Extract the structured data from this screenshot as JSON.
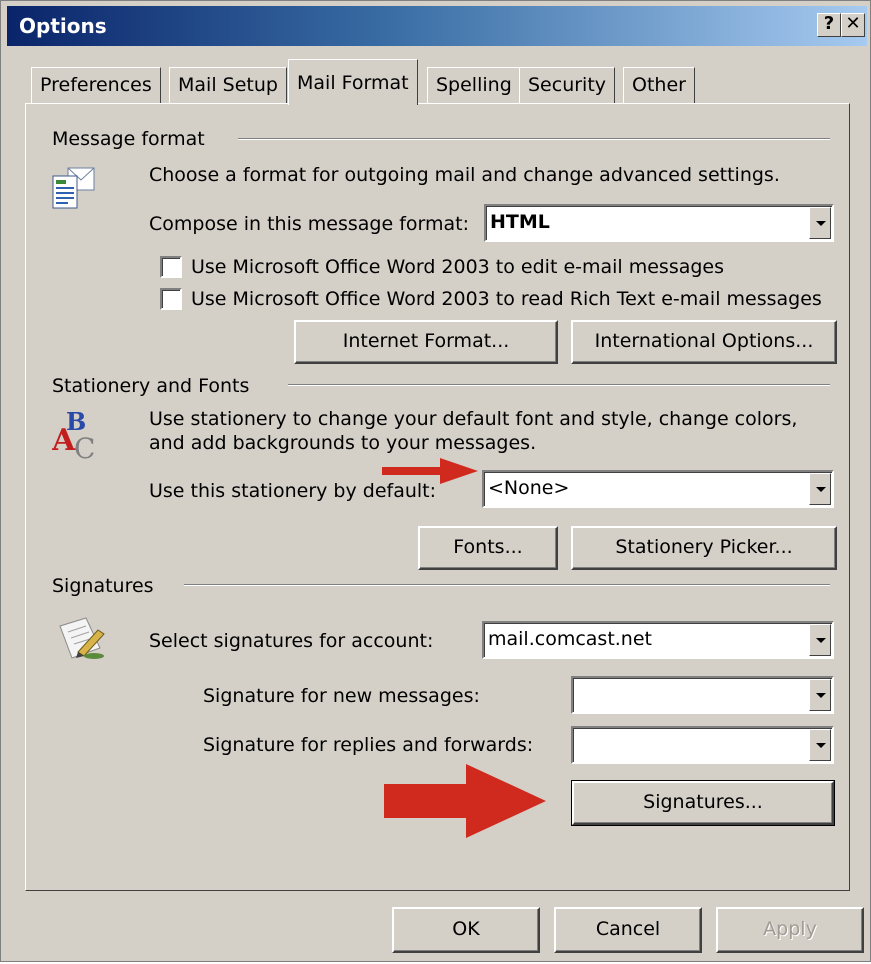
{
  "window": {
    "title": "Options",
    "help_label": "?",
    "close_label": "✕"
  },
  "tabs": [
    {
      "label": "Preferences"
    },
    {
      "label": "Mail Setup"
    },
    {
      "label": "Mail Format",
      "active": true
    },
    {
      "label": "Spelling"
    },
    {
      "label": "Security"
    },
    {
      "label": "Other"
    }
  ],
  "message_format": {
    "heading": "Message format",
    "description": "Choose a format for outgoing mail and change advanced settings.",
    "compose_label": "Compose in this message format:",
    "compose_value": "HTML",
    "word_edit_label": "Use Microsoft Office Word 2003 to edit e-mail messages",
    "word_read_label": "Use Microsoft Office Word 2003 to read Rich Text e-mail messages",
    "word_edit_checked": false,
    "word_read_checked": false,
    "internet_format_button": "Internet Format...",
    "international_options_button": "International Options..."
  },
  "stationery": {
    "heading": "Stationery and Fonts",
    "description_line1": "Use stationery to change your default font and style, change colors,",
    "description_line2": "and add backgrounds to your messages.",
    "default_label": "Use this stationery by default:",
    "default_value": "<None>",
    "fonts_button": "Fonts...",
    "picker_button": "Stationery Picker..."
  },
  "signatures": {
    "heading": "Signatures",
    "account_label": "Select signatures for account:",
    "account_value": "mail.comcast.net",
    "new_messages_label": "Signature for new messages:",
    "new_messages_value": "",
    "replies_label": "Signature for replies and forwards:",
    "replies_value": "",
    "signatures_button": "Signatures..."
  },
  "footer": {
    "ok_label": "OK",
    "cancel_label": "Cancel",
    "apply_label": "Apply"
  },
  "colors": {
    "annotation_arrow": "#d02a1f",
    "dialog_face": "#d4d0c8",
    "title_gradient_start": "#0a246a"
  }
}
